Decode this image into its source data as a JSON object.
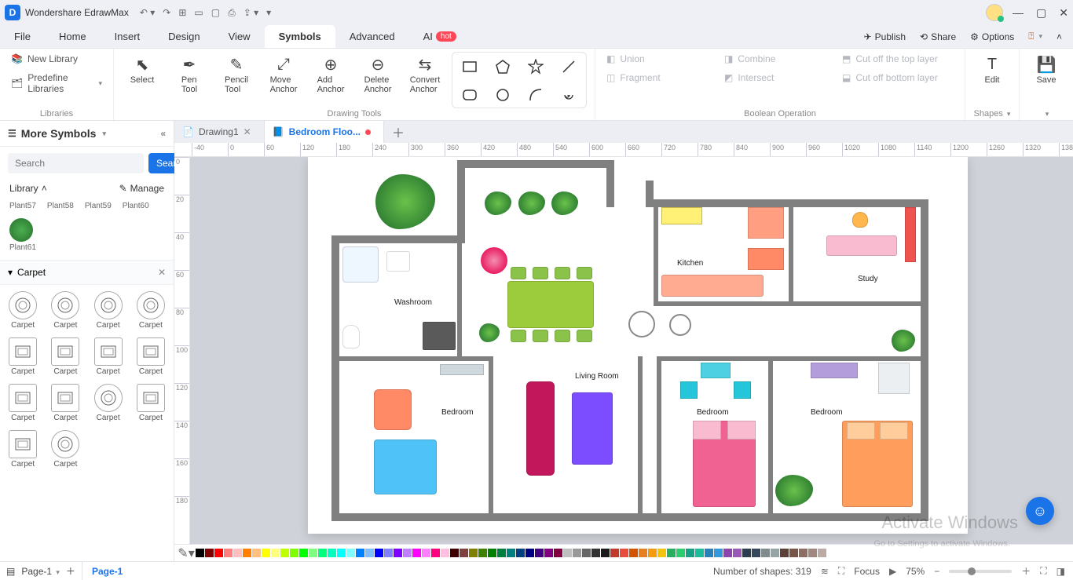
{
  "app": {
    "title": "Wondershare EdrawMax"
  },
  "menubar": {
    "items": [
      "File",
      "Home",
      "Insert",
      "Design",
      "View",
      "Symbols",
      "Advanced",
      "AI"
    ],
    "active": "Symbols",
    "hot_on": "AI",
    "right": {
      "publish": "Publish",
      "share": "Share",
      "options": "Options"
    }
  },
  "ribbon": {
    "libraries": {
      "new": "New Library",
      "predef": "Predefine Libraries",
      "group": "Libraries"
    },
    "drawing": {
      "select": "Select",
      "pen": "Pen\nTool",
      "pencil": "Pencil\nTool",
      "move": "Move\nAnchor",
      "add": "Add\nAnchor",
      "delete": "Delete\nAnchor",
      "convert": "Convert\nAnchor",
      "group": "Drawing Tools"
    },
    "bool": {
      "union": "Union",
      "combine": "Combine",
      "cuttop": "Cut off the top layer",
      "fragment": "Fragment",
      "intersect": "Intersect",
      "cutbot": "Cut off bottom layer",
      "group": "Boolean Operation"
    },
    "edit": {
      "label": "Edit",
      "sub": "Shapes"
    },
    "save": {
      "label": "Save"
    }
  },
  "doctabs": {
    "tabs": [
      {
        "label": "Drawing1",
        "active": false,
        "closeable": true,
        "modified": false
      },
      {
        "label": "Bedroom Floo...",
        "active": true,
        "closeable": false,
        "modified": true
      }
    ]
  },
  "ruler_h": [
    -40,
    0,
    60,
    120,
    180,
    240,
    300
  ],
  "ruler_v": [
    0,
    40,
    80,
    120,
    160
  ],
  "leftpanel": {
    "title": "More Symbols",
    "search_placeholder": "Search",
    "search_btn": "Search",
    "library_label": "Library",
    "manage": "Manage",
    "plants": [
      "Plant57",
      "Plant58",
      "Plant59",
      "Plant60"
    ],
    "plant_single": "Plant61",
    "section": "Carpet",
    "carpet_item_label": "Carpet"
  },
  "floorplan": {
    "rooms": {
      "washroom": "Washroom",
      "kitchen": "Kitchen",
      "study": "Study",
      "living": "Living Room",
      "bed1": "Bedroom",
      "bed2": "Bedroom",
      "bed3": "Bedroom"
    }
  },
  "colorbar": [
    "#000000",
    "#7f0000",
    "#ff0000",
    "#ff7f7f",
    "#ffbfbf",
    "#ff7f00",
    "#ffbf7f",
    "#ffff00",
    "#ffff7f",
    "#bfff00",
    "#7fff00",
    "#00ff00",
    "#7fff7f",
    "#00ff7f",
    "#00ffbf",
    "#00ffff",
    "#7fffff",
    "#007fff",
    "#7fbfff",
    "#0000ff",
    "#7f7fff",
    "#7f00ff",
    "#bf7fff",
    "#ff00ff",
    "#ff7fff",
    "#ff007f",
    "#ffbfdf",
    "#400000",
    "#804040",
    "#808000",
    "#408000",
    "#008000",
    "#008040",
    "#008080",
    "#004080",
    "#000080",
    "#400080",
    "#800080",
    "#800040",
    "#bfbfbf",
    "#999999",
    "#666666",
    "#333333",
    "#1a1a1a",
    "#c0392b",
    "#e74c3c",
    "#d35400",
    "#e67e22",
    "#f39c12",
    "#f1c40f",
    "#27ae60",
    "#2ecc71",
    "#16a085",
    "#1abc9c",
    "#2980b9",
    "#3498db",
    "#8e44ad",
    "#9b59b6",
    "#2c3e50",
    "#34495e",
    "#7f8c8d",
    "#95a5a6",
    "#5d4037",
    "#795548",
    "#8d6e63",
    "#a1887f",
    "#bcaaa4"
  ],
  "bottom": {
    "page_selector": "Page-1",
    "page_tab": "Page-1",
    "shapes": "Number of shapes: 319",
    "focus": "Focus",
    "zoom": "75%"
  },
  "watermark": "Activate Windows",
  "watermark2": "Go to Settings to activate Windows."
}
